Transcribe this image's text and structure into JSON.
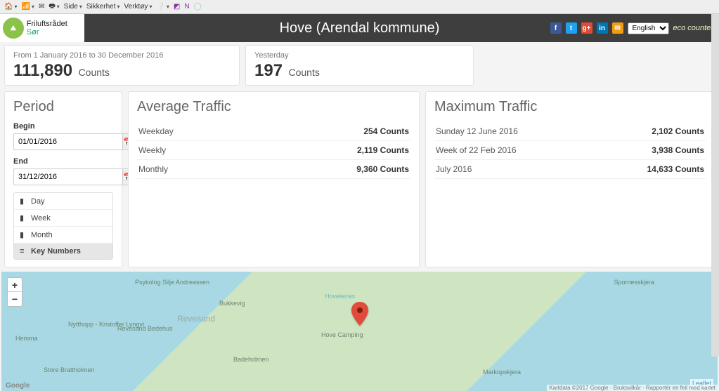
{
  "toolbar": {
    "items": [
      "Side",
      "Sikkerhet",
      "Verktøy"
    ]
  },
  "header": {
    "brand_pre": "Friluftsrådet",
    "brand_suf": "Sør",
    "title": "Hove (Arendal kommune)",
    "lang": "English",
    "eco": "eco counter"
  },
  "social": {
    "fb": "f",
    "tw": "t",
    "gp": "g+",
    "li": "in",
    "ml": "✉"
  },
  "stats": {
    "range": "From 1 January 2016 to 30 December 2016",
    "total_value": "111,890",
    "total_unit": "Counts",
    "yesterday_label": "Yesterday",
    "yesterday_value": "197",
    "yesterday_unit": "Counts"
  },
  "period": {
    "title": "Period",
    "begin_label": "Begin",
    "begin_value": "01/01/2016",
    "end_label": "End",
    "end_value": "31/12/2016",
    "views": [
      "Day",
      "Week",
      "Month",
      "Key Numbers"
    ]
  },
  "avg": {
    "title": "Average Traffic",
    "rows": [
      {
        "label": "Weekday",
        "value": "254 Counts"
      },
      {
        "label": "Weekly",
        "value": "2,119 Counts"
      },
      {
        "label": "Monthly",
        "value": "9,360 Counts"
      }
    ]
  },
  "max": {
    "title": "Maximum Traffic",
    "rows": [
      {
        "label": "Sunday 12 June 2016",
        "value": "2,102 Counts"
      },
      {
        "label": "Week of 22 Feb 2016",
        "value": "3,938 Counts"
      },
      {
        "label": "July 2016",
        "value": "14,633 Counts"
      }
    ]
  },
  "map": {
    "labels": {
      "psykolog": "Psykolog Silje Andreassen",
      "bukkevig": "Bukkevig",
      "revesand": "Revesand",
      "nytthopp": "Nytthopp - Kristoffer Lyngvi",
      "bedehus": "Revesand Bedehus",
      "hove": "Hove Camping",
      "badeholmen": "Badeholmen",
      "hoveleiren": "Hoveleiren",
      "store": "Store Brattholmen",
      "hemma": "Hemma",
      "spornes": "Spornesskjera",
      "markop": "Markopskjera"
    },
    "leaflet": "Leaflet",
    "google": "Google",
    "attr": "Kartdata ©2017 Google · Bruksvilkår · Rapportér en feil med kartet"
  }
}
